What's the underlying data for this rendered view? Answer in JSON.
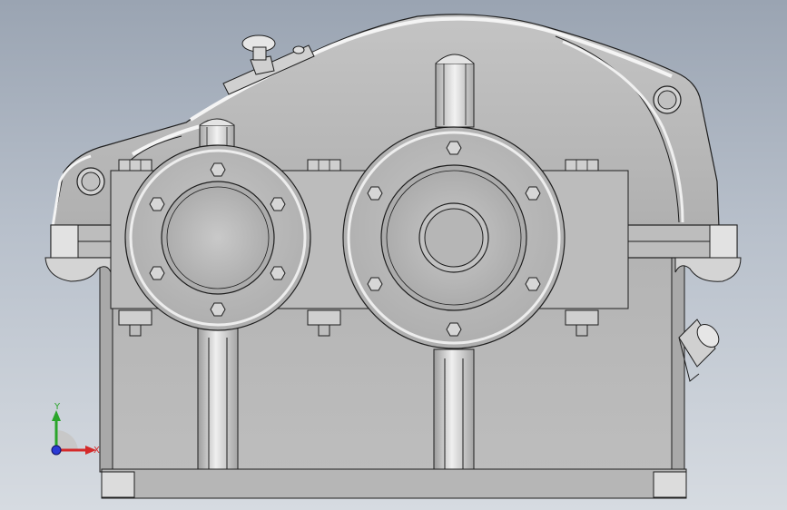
{
  "viewport": {
    "background_top": "#9aa4b2",
    "background_bottom": "#d6dbe1"
  },
  "model": {
    "body_color": "#b9b9b9",
    "body_shade": "#a9a9a9",
    "highlight": "#ececec",
    "edge_color": "#1e1e1e",
    "parts": [
      "housing-cover",
      "housing-base",
      "split-flange",
      "left-bearing-cap",
      "right-bearing-cap",
      "left-bearing-boss",
      "right-bearing-boss",
      "vent-plug",
      "oil-level-indicator",
      "lifting-lug-left",
      "lifting-lug-right",
      "flange-bolts",
      "cap-bolts",
      "base-plate"
    ]
  },
  "triad": {
    "x_label": "X",
    "y_label": "Y",
    "x_color": "#d42a2a",
    "y_color": "#2aa52a",
    "z_color": "#2a3ad4"
  }
}
